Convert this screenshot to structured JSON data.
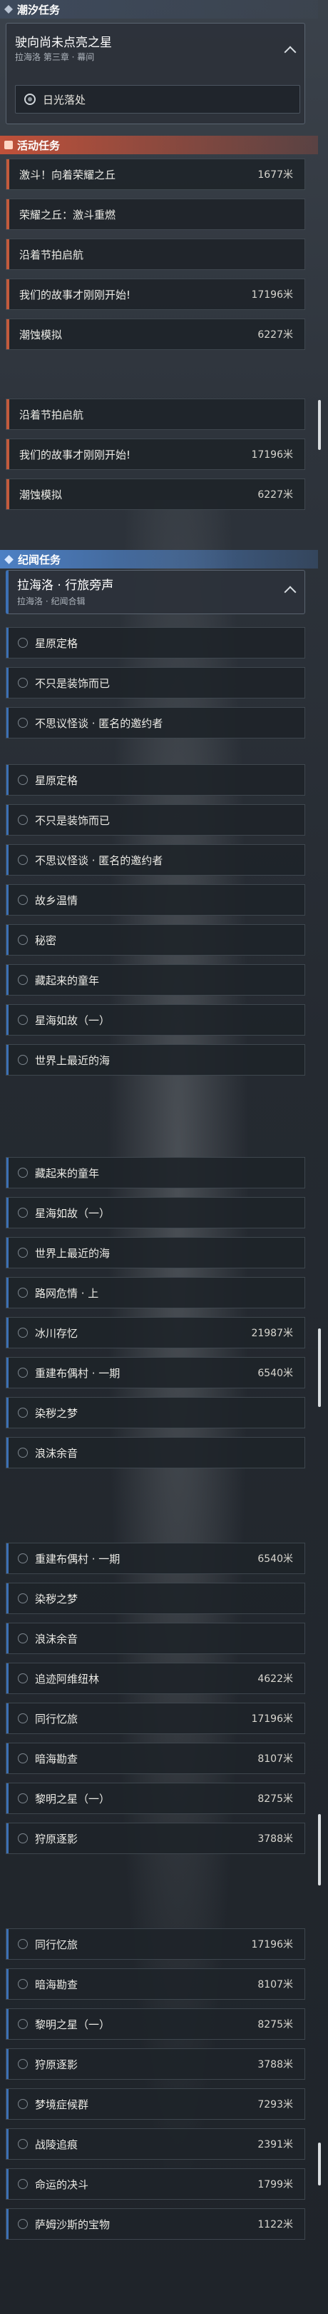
{
  "sections": {
    "tide": "潮汐任务",
    "event": "活动任务",
    "chronicle": "纪闻任务"
  },
  "tide_quest": {
    "title": "驶向尚未点亮之星",
    "subtitle": "拉海洛 第三章 · 幕间",
    "subtask": "日光落处"
  },
  "event_rows_a": [
    {
      "name": "激斗！向着荣耀之丘",
      "distance": "1677米"
    },
    {
      "name": "荣耀之丘：激斗重燃",
      "distance": ""
    },
    {
      "name": "沿着节拍启航",
      "distance": ""
    },
    {
      "name": "我们的故事才刚刚开始!",
      "distance": "17196米"
    },
    {
      "name": "潮蚀模拟",
      "distance": "6227米"
    }
  ],
  "event_rows_b": [
    {
      "name": "沿着节拍启航",
      "distance": ""
    },
    {
      "name": "我们的故事才刚刚开始!",
      "distance": "17196米"
    },
    {
      "name": "潮蚀模拟",
      "distance": "6227米"
    }
  ],
  "chronicle_quest": {
    "title": "拉海洛 · 行旅旁声",
    "subtitle": "拉海洛 · 纪闻合辑"
  },
  "chron_rows_1": [
    {
      "name": "星原定格",
      "distance": ""
    },
    {
      "name": "不只是装饰而已",
      "distance": ""
    },
    {
      "name": "不思议怪谈 · 匿名的邀约者",
      "distance": ""
    }
  ],
  "chron_rows_2": [
    {
      "name": "星原定格",
      "distance": ""
    },
    {
      "name": "不只是装饰而已",
      "distance": ""
    },
    {
      "name": "不思议怪谈 · 匿名的邀约者",
      "distance": ""
    },
    {
      "name": "故乡温情",
      "distance": ""
    },
    {
      "name": "秘密",
      "distance": ""
    },
    {
      "name": "藏起来的童年",
      "distance": ""
    },
    {
      "name": "星海如故（一）",
      "distance": ""
    },
    {
      "name": "世界上最近的海",
      "distance": ""
    }
  ],
  "chron_rows_3": [
    {
      "name": "藏起来的童年",
      "distance": ""
    },
    {
      "name": "星海如故（一）",
      "distance": ""
    },
    {
      "name": "世界上最近的海",
      "distance": ""
    },
    {
      "name": "路网危情 · 上",
      "distance": ""
    },
    {
      "name": "冰川存忆",
      "distance": "21987米"
    },
    {
      "name": "重建布偶村 · 一期",
      "distance": "6540米"
    },
    {
      "name": "染秽之梦",
      "distance": ""
    },
    {
      "name": "浪沫余音",
      "distance": ""
    }
  ],
  "chron_rows_4": [
    {
      "name": "重建布偶村 · 一期",
      "distance": "6540米"
    },
    {
      "name": "染秽之梦",
      "distance": ""
    },
    {
      "name": "浪沫余音",
      "distance": ""
    },
    {
      "name": "追迹阿维纽林",
      "distance": "4622米"
    },
    {
      "name": "同行忆旅",
      "distance": "17196米"
    },
    {
      "name": "暗海勘查",
      "distance": "8107米"
    },
    {
      "name": "黎明之星（一）",
      "distance": "8275米"
    },
    {
      "name": "狩原逐影",
      "distance": "3788米"
    }
  ],
  "chron_rows_5": [
    {
      "name": "同行忆旅",
      "distance": "17196米"
    },
    {
      "name": "暗海勘查",
      "distance": "8107米"
    },
    {
      "name": "黎明之星（一）",
      "distance": "8275米"
    },
    {
      "name": "狩原逐影",
      "distance": "3788米"
    },
    {
      "name": "梦境症候群",
      "distance": "7293米"
    },
    {
      "name": "战陵追痕",
      "distance": "2391米"
    },
    {
      "name": "命运的决斗",
      "distance": "1799米"
    },
    {
      "name": "萨姆沙斯的宝物",
      "distance": "1122米"
    }
  ],
  "colors": {
    "event_accent": "#c35a3c",
    "chronicle_accent": "#3c70b4",
    "tide_header": "#3e4a5c"
  }
}
